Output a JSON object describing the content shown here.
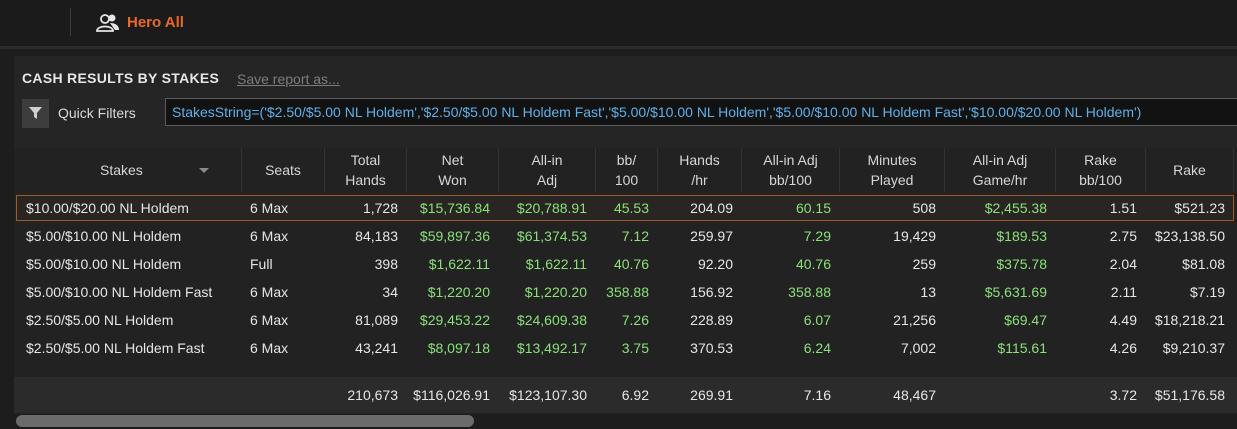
{
  "header": {
    "profile_label": "Hero All"
  },
  "report": {
    "title": "CASH RESULTS BY STAKES",
    "save_link": "Save report as..."
  },
  "filters": {
    "label": "Quick Filters",
    "value": "StakesString=('$2.50/$5.00 NL Holdem','$2.50/$5.00 NL Holdem Fast','$5.00/$10.00 NL Holdem','$5.00/$10.00 NL Holdem Fast','$10.00/$20.00 NL Holdem')"
  },
  "table": {
    "columns": [
      {
        "line1": "Stakes",
        "line2": ""
      },
      {
        "line1": "Seats",
        "line2": ""
      },
      {
        "line1": "Total",
        "line2": "Hands"
      },
      {
        "line1": "Net",
        "line2": "Won"
      },
      {
        "line1": "All-in",
        "line2": "Adj"
      },
      {
        "line1": "bb/",
        "line2": "100"
      },
      {
        "line1": "Hands",
        "line2": "/hr"
      },
      {
        "line1": "All-in Adj",
        "line2": "bb/100"
      },
      {
        "line1": "Minutes",
        "line2": "Played"
      },
      {
        "line1": "All-in Adj",
        "line2": "Game/hr"
      },
      {
        "line1": "Rake",
        "line2": "bb/100"
      },
      {
        "line1": "Rake",
        "line2": ""
      }
    ],
    "rows": [
      [
        "$10.00/$20.00 NL Holdem",
        "6 Max",
        "1,728",
        "$15,736.84",
        "$20,788.91",
        "45.53",
        "204.09",
        "60.15",
        "508",
        "$2,455.38",
        "1.51",
        "$521.23"
      ],
      [
        "$5.00/$10.00 NL Holdem",
        "6 Max",
        "84,183",
        "$59,897.36",
        "$61,374.53",
        "7.12",
        "259.97",
        "7.29",
        "19,429",
        "$189.53",
        "2.75",
        "$23,138.50"
      ],
      [
        "$5.00/$10.00 NL Holdem",
        "Full",
        "398",
        "$1,622.11",
        "$1,622.11",
        "40.76",
        "92.20",
        "40.76",
        "259",
        "$375.78",
        "2.04",
        "$81.08"
      ],
      [
        "$5.00/$10.00 NL Holdem Fast",
        "6 Max",
        "34",
        "$1,220.20",
        "$1,220.20",
        "358.88",
        "156.92",
        "358.88",
        "13",
        "$5,631.69",
        "2.11",
        "$7.19"
      ],
      [
        "$2.50/$5.00 NL Holdem",
        "6 Max",
        "81,089",
        "$29,453.22",
        "$24,609.38",
        "7.26",
        "228.89",
        "6.07",
        "21,256",
        "$69.47",
        "4.49",
        "$18,218.21"
      ],
      [
        "$2.50/$5.00 NL Holdem Fast",
        "6 Max",
        "43,241",
        "$8,097.18",
        "$13,492.17",
        "3.75",
        "370.53",
        "6.24",
        "7,002",
        "$115.61",
        "4.26",
        "$9,210.37"
      ]
    ],
    "totals": [
      "",
      "",
      "210,673",
      "$116,026.91",
      "$123,107.30",
      "6.92",
      "269.91",
      "7.16",
      "48,467",
      "",
      "3.72",
      "$51,176.58"
    ]
  },
  "colors": {
    "accent": "#e8692a",
    "positive": "#8be07a",
    "filter_text": "#5fb0ea"
  },
  "icons": {
    "profile": "users-icon",
    "filter": "filter-icon",
    "sort": "sort-caret-icon"
  }
}
